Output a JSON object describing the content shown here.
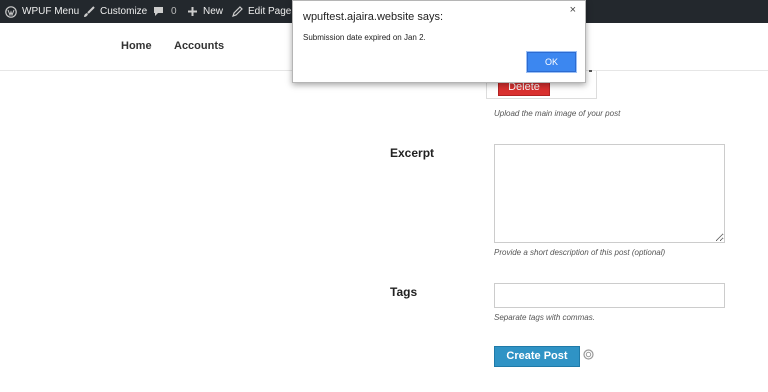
{
  "admin_bar": {
    "items": [
      {
        "label": "WPUF Menu",
        "icon": "wordpress-icon"
      },
      {
        "label": "Customize",
        "icon": "paintbrush-icon"
      },
      {
        "label": "",
        "icon": "comment-icon",
        "count": "0"
      },
      {
        "label": "New",
        "icon": "plus-icon"
      },
      {
        "label": "Edit Page",
        "icon": "pencil-icon"
      }
    ]
  },
  "nav": {
    "home": "Home",
    "accounts": "Accounts"
  },
  "form": {
    "delete_label": "Delete",
    "image_help": "Upload the main image of your post",
    "excerpt_label": "Excerpt",
    "excerpt_value": "",
    "excerpt_help": "Provide a short description of this post (optional)",
    "tags_label": "Tags",
    "tags_value": "",
    "tags_help": "Separate tags with commas.",
    "submit_label": "Create Post"
  },
  "dialog": {
    "title": "wpuftest.ajaira.website says:",
    "message": "Submission date expired on Jan 2.",
    "ok_label": "OK",
    "close_glyph": "×"
  },
  "colors": {
    "admin_bar": "#23282d",
    "delete": "#d9302f",
    "submit": "#2f93c5",
    "ok_button": "#3c87f0"
  }
}
